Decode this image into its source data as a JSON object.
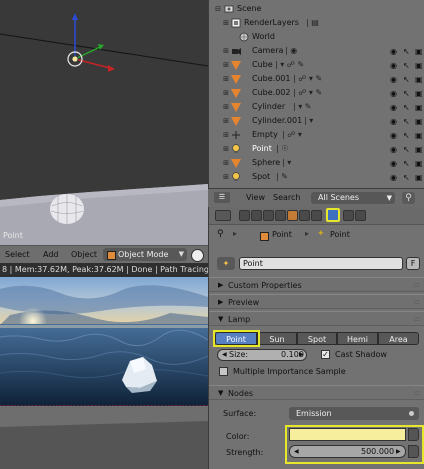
{
  "viewport": {
    "object_label": "Point"
  },
  "viewport_header": {
    "select": "Select",
    "add": "Add",
    "object": "Object",
    "mode": "Object Mode"
  },
  "status": {
    "text": "8 | Mem:37.62M, Peak:37.62M | Done | Path Tracing Sa"
  },
  "outliner": {
    "rows": [
      {
        "label": "Scene"
      },
      {
        "label": "RenderLayers"
      },
      {
        "label": "World"
      },
      {
        "label": "Camera"
      },
      {
        "label": "Cube"
      },
      {
        "label": "Cube.001"
      },
      {
        "label": "Cube.002"
      },
      {
        "label": "Cylinder"
      },
      {
        "label": "Cylinder.001"
      },
      {
        "label": "Empty"
      },
      {
        "label": "Point"
      },
      {
        "label": "Sphere"
      },
      {
        "label": "Spot"
      }
    ],
    "header": {
      "view": "View",
      "search": "Search",
      "scene_filter": "All Scenes"
    }
  },
  "properties": {
    "context": {
      "object": "Point",
      "data": "Point"
    },
    "name_field": "Point",
    "fake_user": "F",
    "panels": {
      "custom_properties": "Custom Properties",
      "preview": "Preview",
      "lamp": "Lamp",
      "nodes": "Nodes"
    },
    "lamp_types": [
      "Point",
      "Sun",
      "Spot",
      "Hemi",
      "Area"
    ],
    "selected_lamp_type": "Point",
    "size_label": "Size:",
    "size_value": "0.100",
    "cast_shadow": "Cast Shadow",
    "multiple_importance": "Multiple Importance Sample",
    "surface_label": "Surface:",
    "surface_value": "Emission",
    "color_label": "Color:",
    "color_value": "#f7ee9d",
    "strength_label": "Strength:",
    "strength_value": "500.000"
  },
  "colors": {
    "highlight": "#e6e62a",
    "selected": "#5680c2",
    "lamp_orange": "#e6852d"
  }
}
